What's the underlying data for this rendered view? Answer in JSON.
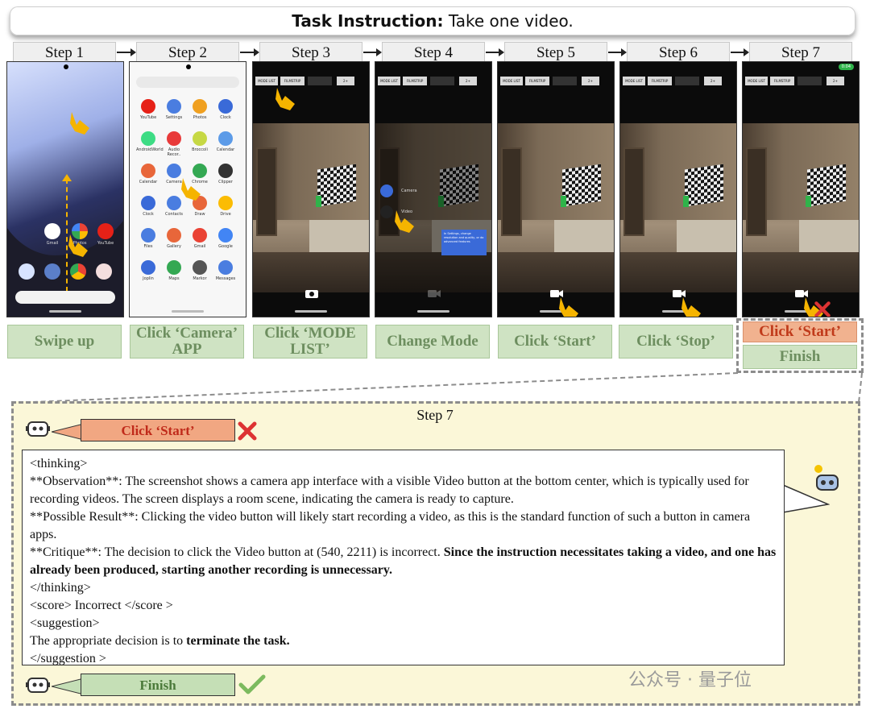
{
  "title": {
    "prefix": "Task Instruction:",
    "text": "Take one video."
  },
  "steps": [
    {
      "header": "Step 1",
      "action": "Swipe up"
    },
    {
      "header": "Step 2",
      "action": "Click ‘Camera’ APP"
    },
    {
      "header": "Step 3",
      "action": "Click ‘MODE LIST’"
    },
    {
      "header": "Step 4",
      "action": "Change Mode"
    },
    {
      "header": "Step 5",
      "action": "Click ‘Start’"
    },
    {
      "header": "Step 6",
      "action": "Click ‘Stop’"
    },
    {
      "header": "Step 7",
      "action_wrong": "Click ‘Start’",
      "action_finish": "Finish"
    }
  ],
  "home_apps": {
    "row1": [
      "Gmail",
      "Photos",
      "YouTube"
    ]
  },
  "drawer_apps": [
    [
      "YouTube",
      "Settings",
      "Photos",
      "Clock"
    ],
    [
      "AndroidWorld",
      "Audio Recor..",
      "Broccoli",
      "Calendar"
    ],
    [
      "Calendar",
      "Camera",
      "Chrome",
      "Clipper"
    ],
    [
      "Clock",
      "Contacts",
      "Draw",
      "Drive"
    ],
    [
      "Files",
      "Gallery",
      "Gmail",
      "Google"
    ],
    [
      "Joplin",
      "Maps",
      "Markor",
      "Messages"
    ]
  ],
  "camera_chips": [
    "MODE LIST",
    "FILMSTRIP",
    "",
    "2+"
  ],
  "mode_menu": [
    "Camera",
    "Video"
  ],
  "tooltip": "In Settings, change resolution and quality, or do advanced features",
  "status_chip": "0:04",
  "detail": {
    "title": "Step 7",
    "wrong_action": "Click ‘Start’",
    "final_action": "Finish",
    "lines": {
      "thinking_open": "<thinking>",
      "obs_label": "**Observation**",
      "obs_text": ": The screenshot shows a camera app interface with a visible Video button at the bottom center, which is typically used for recording videos. The screen displays a room scene, indicating the camera is ready to capture.",
      "result_label": "**Possible Result**",
      "result_text": ": Clicking the video button will likely start recording a video, as this is the standard function of such a button in camera apps.",
      "critique_label": "**Critique**",
      "critique_text": ": The decision to click the Video button at (540, 2211) is incorrect. ",
      "critique_bold": "Since the instruction necessitates taking a video, and one has already been produced, starting another recording is unnecessary.",
      "thinking_close": "</thinking>",
      "score": "<score> Incorrect </score >",
      "suggestion_open": "<suggestion>",
      "suggestion_text": "The appropriate decision is to ",
      "suggestion_bold": "terminate the task.",
      "suggestion_close": "</suggestion >"
    }
  },
  "watermark": "公众号 · 量子位",
  "colors": {
    "wrong": "#f1b28f",
    "correct": "#cfe3c3",
    "panel": "#fbf7d8",
    "hand": "#f5b400"
  }
}
